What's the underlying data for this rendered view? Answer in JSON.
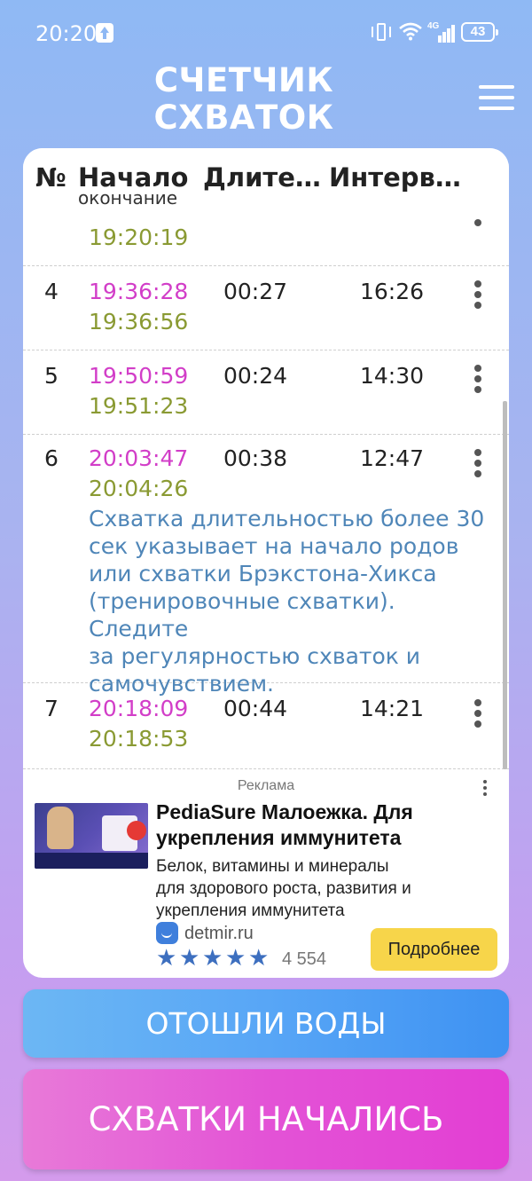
{
  "status_bar": {
    "time": "20:20",
    "battery": "43",
    "network": "4G"
  },
  "header": {
    "title_line1": "СЧЕТЧИК",
    "title_line2": "СХВАТОК"
  },
  "table": {
    "columns": {
      "num": "№",
      "start": "Начало",
      "start_sub": "окончание",
      "duration": "Длите…",
      "interval": "Интерв…"
    },
    "partial_row": {
      "end": "19:20:19"
    },
    "rows": [
      {
        "num": "4",
        "start": "19:36:28",
        "end": "19:36:56",
        "duration": "00:27",
        "interval": "16:26"
      },
      {
        "num": "5",
        "start": "19:50:59",
        "end": "19:51:23",
        "duration": "00:24",
        "interval": "14:30"
      },
      {
        "num": "6",
        "start": "20:03:47",
        "end": "20:04:26",
        "duration": "00:38",
        "interval": "12:47",
        "note_lines": [
          "Схватка длительностью более 30",
          "сек указывает на начало родов",
          "или схватки Брэкстона-Хикса",
          "(тренировочные схватки). Следите",
          "за регулярностью схваток и",
          "самочувствием."
        ]
      },
      {
        "num": "7",
        "start": "20:18:09",
        "end": "20:18:53",
        "duration": "00:44",
        "interval": "14:21"
      }
    ]
  },
  "ad": {
    "label": "Реклама",
    "title_line1": "PediaSure Малоежка. Для",
    "title_line2": "укрепления иммунитета",
    "desc_line1": "Белок, витамины и минералы",
    "desc_line2": "для здорового роста, развития и",
    "desc_line3": "укрепления иммунитета",
    "domain": "detmir.ru",
    "rating": 5,
    "reviews": "4 554",
    "button": "Подробнее"
  },
  "buttons": {
    "water": "ОТОШЛИ ВОДЫ",
    "start": "СХВАТКИ НАЧАЛИСЬ"
  },
  "colors": {
    "start_time": "#d23ec8",
    "end_time": "#8a9a33",
    "note": "#4f86b8",
    "water_button": "#58a6f6",
    "start_button": "#e353d6",
    "ad_button": "#f7d54a"
  }
}
